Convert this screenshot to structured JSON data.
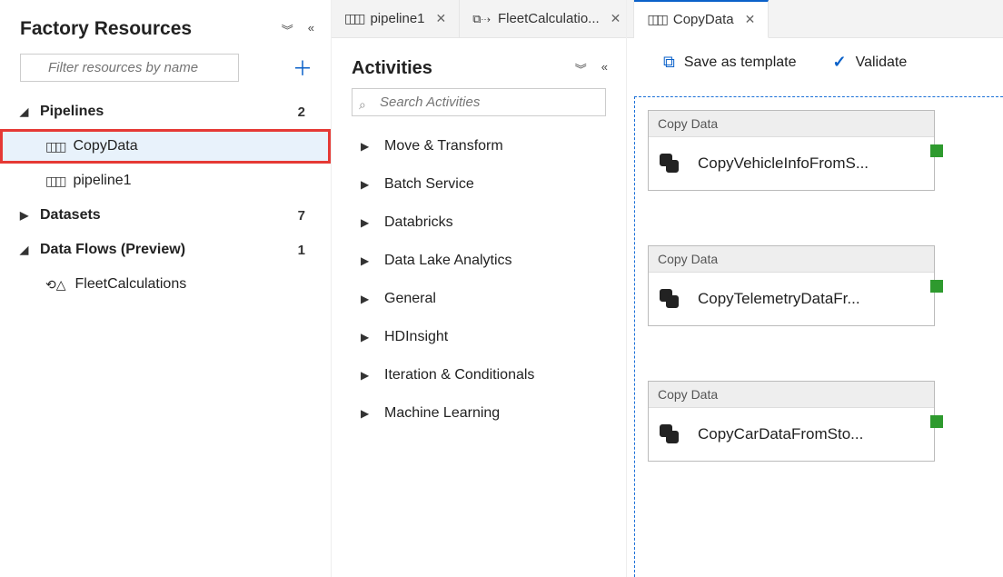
{
  "resources": {
    "title": "Factory Resources",
    "filter_placeholder": "Filter resources by name",
    "groups": [
      {
        "label": "Pipelines",
        "count": "2",
        "expanded": true,
        "items": [
          {
            "label": "CopyData",
            "selected": true,
            "highlighted": true,
            "type": "pipeline"
          },
          {
            "label": "pipeline1",
            "type": "pipeline"
          }
        ]
      },
      {
        "label": "Datasets",
        "count": "7",
        "expanded": false,
        "items": []
      },
      {
        "label": "Data Flows (Preview)",
        "count": "1",
        "expanded": true,
        "items": [
          {
            "label": "FleetCalculations",
            "type": "dataflow"
          }
        ]
      }
    ]
  },
  "tabs": [
    {
      "label": "pipeline1",
      "icon": "pipeline",
      "active": false
    },
    {
      "label": "FleetCalculatio...",
      "icon": "dataflow",
      "active": false
    },
    {
      "label": "CopyData",
      "icon": "pipeline",
      "active": true
    }
  ],
  "activities": {
    "title": "Activities",
    "search_placeholder": "Search Activities",
    "categories": [
      "Move & Transform",
      "Batch Service",
      "Databricks",
      "Data Lake Analytics",
      "General",
      "HDInsight",
      "Iteration & Conditionals",
      "Machine Learning"
    ]
  },
  "toolbar": {
    "save_template": "Save as template",
    "validate": "Validate"
  },
  "canvas": {
    "nodes": [
      {
        "type_label": "Copy Data",
        "name": "CopyVehicleInfoFromS..."
      },
      {
        "type_label": "Copy Data",
        "name": "CopyTelemetryDataFr..."
      },
      {
        "type_label": "Copy Data",
        "name": "CopyCarDataFromSto..."
      }
    ]
  }
}
